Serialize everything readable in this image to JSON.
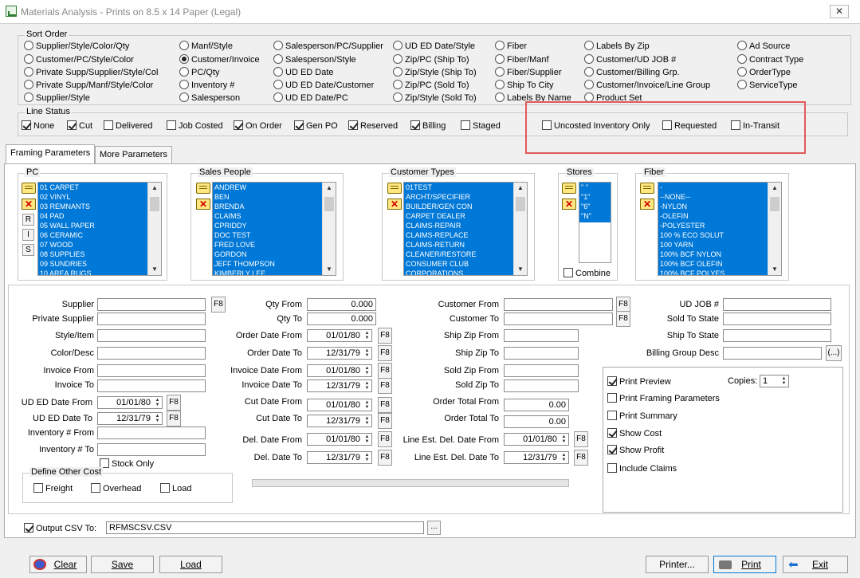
{
  "window": {
    "title": "Materials Analysis  -  Prints on 8.5 x 14 Paper (Legal)",
    "close": "✕"
  },
  "sort_order": {
    "legend": "Sort Order",
    "selected": "Customer/Invoice",
    "col1": [
      "Supplier/Style/Color/Qty",
      "Customer/PC/Style/Color",
      "Private Supp/Supplier/Style/Col",
      "Private Supp/Manf/Style/Color",
      "Supplier/Style"
    ],
    "col2": [
      "Manf/Style",
      "Customer/Invoice",
      "PC/Qty",
      "Inventory #",
      "Salesperson"
    ],
    "col3": [
      "Salesperson/PC/Supplier",
      "Salesperson/Style",
      "UD ED Date",
      "UD ED Date/Customer",
      "UD ED Date/PC"
    ],
    "col4": [
      "UD ED Date/Style",
      "Zip/PC (Ship To)",
      "Zip/Style (Ship To)",
      "Zip/PC (Sold To)",
      "Zip/Style (Sold To)"
    ],
    "col5": [
      "Fiber",
      "Fiber/Manf",
      "Fiber/Supplier",
      "Ship To City",
      "Labels By Name"
    ],
    "col6": [
      "Labels By Zip",
      "Customer/UD JOB #",
      "Customer/Billing Grp.",
      "Customer/Invoice/Line Group",
      "Product Set"
    ],
    "col7": [
      "Ad Source",
      "Contract Type",
      "OrderType",
      "ServiceType"
    ]
  },
  "line_status": {
    "legend": "Line Status",
    "items": [
      {
        "label": "None",
        "checked": true
      },
      {
        "label": "Cut",
        "checked": true
      },
      {
        "label": "Delivered",
        "checked": false
      },
      {
        "label": "Job Costed",
        "checked": false
      },
      {
        "label": "On Order",
        "checked": true
      },
      {
        "label": "Gen PO",
        "checked": true
      },
      {
        "label": "Reserved",
        "checked": true
      },
      {
        "label": "Billing",
        "checked": true
      },
      {
        "label": "Staged",
        "checked": false
      }
    ],
    "extra": [
      {
        "label": "Uncosted Inventory Only",
        "checked": false
      },
      {
        "label": "Requested",
        "checked": false
      },
      {
        "label": "In-Transit",
        "checked": false
      }
    ]
  },
  "tabs": [
    "Framing Parameters",
    "More Parameters"
  ],
  "lists": {
    "pc": {
      "legend": "PC",
      "items": [
        "01   CARPET",
        "02   VINYL",
        "03   REMNANTS",
        "04   PAD",
        "05   WALL PAPER",
        "06   CERAMIC",
        "07   WOOD",
        "08   SUPPLIES",
        "09   SUNDRIES",
        "10   AREA RUGS"
      ],
      "side_buttons": [
        "R",
        "I",
        "S"
      ]
    },
    "sales": {
      "legend": "Sales People",
      "items": [
        "ANDREW",
        "BEN",
        "BRENDA",
        "CLAIMS",
        "CPRIDDY",
        "DOC TEST",
        "FRED LOVE",
        "GORDON",
        "JEFF THOMPSON",
        "KIMBERLY LEE"
      ]
    },
    "custtypes": {
      "legend": "Customer Types",
      "items": [
        "01TEST",
        "ARCHT/SPECIFIER",
        "BUILDER/GEN CON",
        "CARPET DEALER",
        "CLAIMS-REPAIR",
        "CLAIMS-REPLACE",
        "CLAIMS-RETURN",
        "CLEANER/RESTORE",
        "CONSUMER CLUB",
        "CORPORATIONS"
      ]
    },
    "stores": {
      "legend": "Stores",
      "items": [
        "\" \"",
        "\"1\"",
        "\"6\"",
        "\"N\""
      ],
      "combine": "Combine"
    },
    "fiber": {
      "legend": "Fiber",
      "items": [
        "-",
        "--NONE--",
        "-NYLON",
        "-OLEFIN",
        "-POLYESTER",
        "100 % ECO SOLUT",
        "100 YARN",
        "100% BCF NYLON",
        "100% BCF OLEFIN",
        "100% BCF POLYES"
      ]
    }
  },
  "fields": {
    "supplier": "Supplier",
    "private_supplier": "Private Supplier",
    "style_item": "Style/Item",
    "color_desc": "Color/Desc",
    "invoice_from": "Invoice From",
    "invoice_to": "Invoice To",
    "ud_ed_from": "UD ED Date From",
    "ud_ed_to": "UD ED Date To",
    "inv_from": "Inventory # From",
    "inv_to": "Inventory # To",
    "stock_only": "Stock Only",
    "ud_ed_from_val": "01/01/80",
    "ud_ed_to_val": "12/31/79",
    "qty_from": "Qty From",
    "qty_to": "Qty To",
    "qty_from_val": "0.000",
    "qty_to_val": "0.000",
    "order_from": "Order Date From",
    "order_to": "Order Date To",
    "order_from_val": "01/01/80",
    "order_to_val": "12/31/79",
    "invd_from": "Invoice Date From",
    "invd_to": "Invoice Date To",
    "invd_from_val": "01/01/80",
    "invd_to_val": "12/31/79",
    "cut_from": "Cut Date From",
    "cut_to": "Cut Date To",
    "cut_from_val": "01/01/80",
    "cut_to_val": "12/31/79",
    "del_from": "Del. Date From",
    "del_to": "Del. Date To",
    "del_from_val": "01/01/80",
    "del_to_val": "12/31/79",
    "cust_from": "Customer From",
    "cust_to": "Customer To",
    "shipzip_from": "Ship Zip From",
    "shipzip_to": "Ship Zip To",
    "soldzip_from": "Sold Zip From",
    "soldzip_to": "Sold Zip To",
    "ordtot_from": "Order Total From",
    "ordtot_to": "Order Total To",
    "ordtot_from_val": "0.00",
    "ordtot_to_val": "0.00",
    "line_del_from": "Line Est. Del. Date From",
    "line_del_to": "Line Est. Del. Date To",
    "line_del_from_val": "01/01/80",
    "line_del_to_val": "12/31/79",
    "udjob": "UD JOB #",
    "sold_state": "Sold To State",
    "ship_state": "Ship To State",
    "billing_group": "Billing Group Desc",
    "f8": "F8",
    "ellipsis": "(...)",
    "ellipsis2": "..."
  },
  "other_cost": {
    "legend": "Define Other Cost",
    "items": [
      "Freight",
      "Overhead",
      "Load"
    ]
  },
  "print_opts": {
    "copies_label": "Copies:",
    "copies": "1",
    "items": [
      {
        "label": "Print Preview",
        "checked": true
      },
      {
        "label": "Print Framing Parameters",
        "checked": false
      },
      {
        "label": "Print Summary",
        "checked": false
      },
      {
        "label": "Show Cost",
        "checked": true
      },
      {
        "label": "Show Profit",
        "checked": true
      },
      {
        "label": "Include Claims",
        "checked": false
      }
    ]
  },
  "csv": {
    "label": "Output CSV To:",
    "checked": true,
    "value": "RFMSCSV.CSV"
  },
  "buttons": {
    "clear": "Clear",
    "save": "Save",
    "load": "Load",
    "printer": "Printer...",
    "print": "Print",
    "exit": "Exit"
  }
}
